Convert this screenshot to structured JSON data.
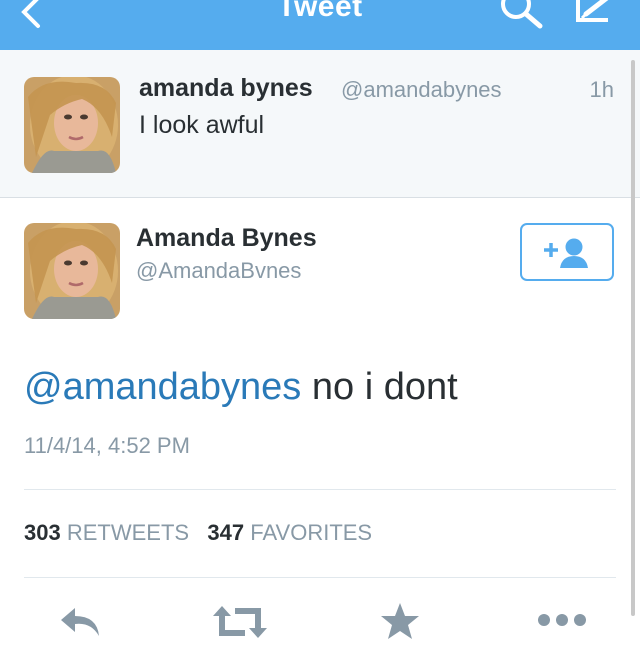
{
  "nav": {
    "title": "Tweet",
    "icons": [
      "back-chevron-icon",
      "search-icon",
      "compose-icon"
    ]
  },
  "parent_tweet": {
    "name": "amanda bynes",
    "handle": "@amandabynes",
    "time": "1h",
    "text": "I look awful"
  },
  "main_tweet": {
    "name": "Amanda Bynes",
    "handle": "@AmandaBvnes",
    "mention": "@amandabynes",
    "text": " no i dont",
    "timestamp": "11/4/14, 4:52 PM",
    "retweet_count": "303",
    "retweet_label": "RETWEETS",
    "favorite_count": "347",
    "favorite_label": "FAVORITES"
  },
  "actions": [
    "reply-icon",
    "retweet-icon",
    "favorite-star-icon",
    "more-icon"
  ],
  "colors": {
    "accent": "#55acee",
    "link": "#2a7ab8",
    "text": "#292f33",
    "muted": "#8899a6",
    "action_gray": "#8899a6"
  }
}
